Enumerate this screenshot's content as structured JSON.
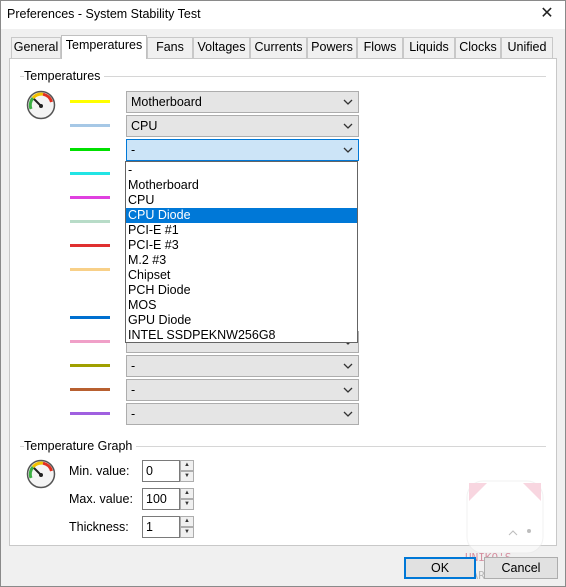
{
  "window": {
    "title": "Preferences - System Stability Test",
    "close_glyph": "✕"
  },
  "tabs": [
    "General",
    "Temperatures",
    "Fans",
    "Voltages",
    "Currents",
    "Powers",
    "Flows",
    "Liquids",
    "Clocks",
    "Unified"
  ],
  "active_tab": "Temperatures",
  "temperatures": {
    "group_label": "Temperatures",
    "rows": [
      {
        "color": "#ffff00",
        "value": "Motherboard"
      },
      {
        "color": "#a6c8e6",
        "value": "CPU"
      },
      {
        "color": "#00e000",
        "value": "-"
      },
      {
        "color": "#22e4e4",
        "value": ""
      },
      {
        "color": "#e040e0",
        "value": ""
      },
      {
        "color": "#b8dcc8",
        "value": ""
      },
      {
        "color": "#e03030",
        "value": ""
      },
      {
        "color": "#f8d088",
        "value": ""
      },
      {
        "color": "#0070d0",
        "value": ""
      },
      {
        "color": "#f0a0c8",
        "value": ""
      },
      {
        "color": "#a0a000",
        "value": "-"
      },
      {
        "color": "#b86030",
        "value": "-"
      },
      {
        "color": "#a060e0",
        "value": "-"
      }
    ],
    "dropdown_options": [
      "-",
      "Motherboard",
      "CPU",
      "CPU Diode",
      "PCI-E #1",
      "PCI-E #3",
      "M.2 #3",
      "Chipset",
      "PCH Diode",
      "MOS",
      "GPU Diode",
      "INTEL SSDPEKNW256G8"
    ],
    "dropdown_selected": "CPU Diode"
  },
  "graph": {
    "group_label": "Temperature Graph",
    "min_label": "Min. value:",
    "min_value": "0",
    "max_label": "Max. value:",
    "max_value": "100",
    "thickness_label": "Thickness:",
    "thickness_value": "1"
  },
  "buttons": {
    "ok": "OK",
    "cancel": "Cancel"
  },
  "watermark": {
    "line1": "UNIKO'S",
    "line2": "HARDWARE"
  }
}
